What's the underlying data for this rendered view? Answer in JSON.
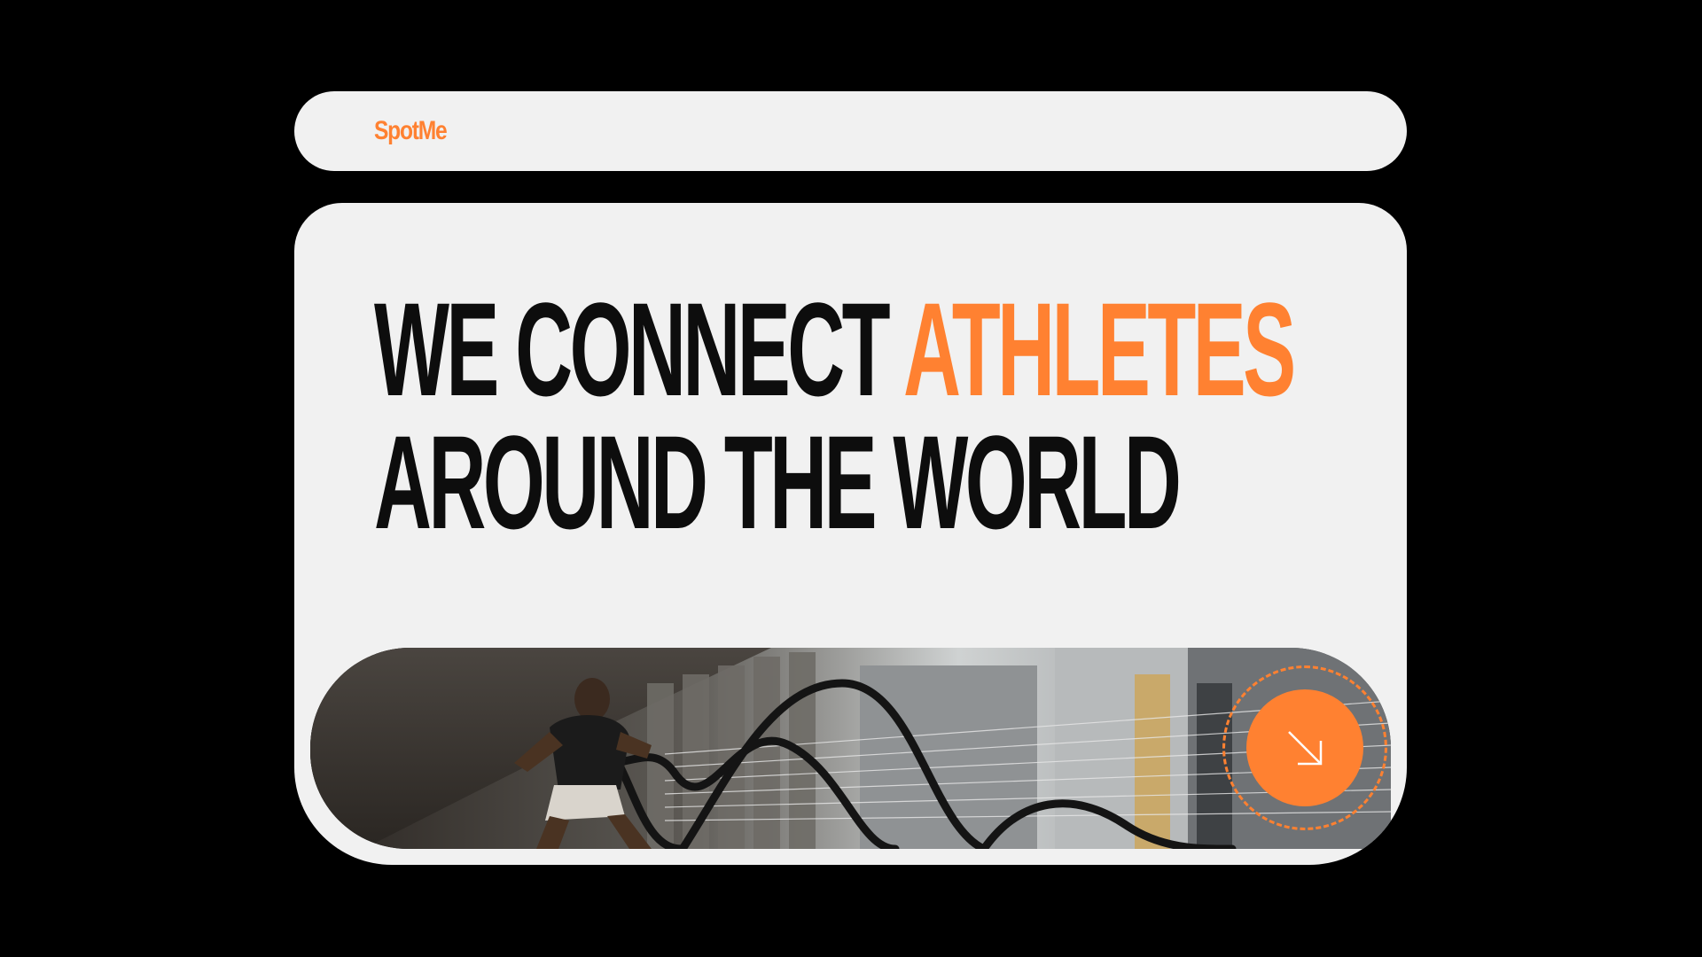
{
  "brand": {
    "name": "SpotMe",
    "accent_color": "#ff8131"
  },
  "hero": {
    "line1_prefix": "WE CONNECT ",
    "line1_accent": "ATHLETES",
    "line2": "AROUND THE WORLD",
    "image_semantic": "athlete-battle-ropes-photo",
    "cta_icon": "arrow-down-right-icon"
  }
}
